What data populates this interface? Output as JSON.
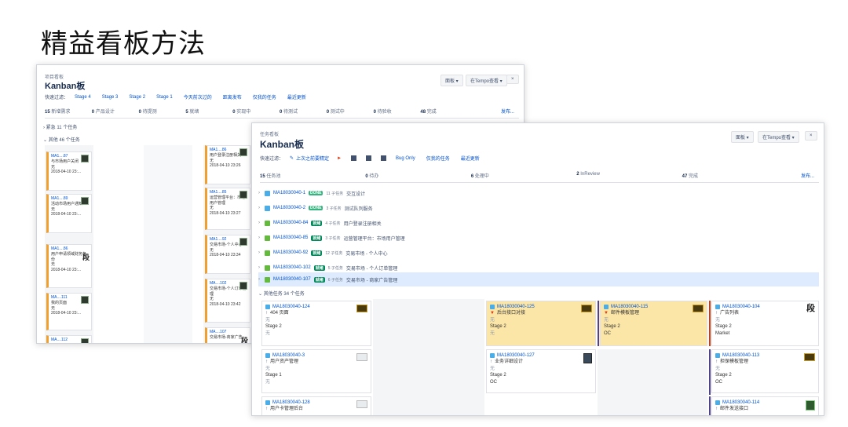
{
  "slide": {
    "title": "精益看板方法"
  },
  "shot1": {
    "crumb": "项目看板",
    "title": "Kanban板",
    "toolbar": {
      "board": "面板 ▾",
      "tempo": "在Tempo查看 ▾",
      "more": "×"
    },
    "quick_label": "快速过滤：",
    "quick_filters": [
      "Stage 4",
      "Stage 3",
      "Stage 2",
      "Stage 1",
      "今天前次过的",
      "距离发布",
      "仅我的任务",
      "最近更新"
    ],
    "columns": [
      {
        "count": "15",
        "name": "新增需求"
      },
      {
        "count": "0",
        "name": "产品设计"
      },
      {
        "count": "0",
        "name": "待提测"
      },
      {
        "count": "5",
        "name": "就绪"
      },
      {
        "count": "0",
        "name": "实现中"
      },
      {
        "count": "0",
        "name": "待测试"
      },
      {
        "count": "0",
        "name": "测试中"
      },
      {
        "count": "0",
        "name": "待验收"
      },
      {
        "count": "48",
        "name": "完成"
      }
    ],
    "release_label": "发布...",
    "swim1": "› 紧急 11 个任务",
    "swim2": "⌄ 其他 46 个任务",
    "cards_left": [
      {
        "key": "MA1....87",
        "title": "与市场用户关闭",
        "none": "无",
        "time": "2018-04-10 23:..."
      },
      {
        "key": "MA1....89",
        "title": "活动市场用户通知",
        "none": "无",
        "time": "2018-04-10 23:..."
      },
      {
        "key": "MA1....86",
        "title": "用户申请领域财务备份",
        "none": "无",
        "time": "2018-04-10 23:..."
      },
      {
        "key": "MA....111",
        "title": "我的页面",
        "none": "无",
        "time": "2018-04-10 23:..."
      },
      {
        "key": "MA....112",
        "title": "",
        "none": "",
        "time": ""
      }
    ],
    "cards_right": [
      {
        "key": "MA1....86",
        "title": "用户登录注册相关",
        "none": "无",
        "time": "2018-04-10 23:26"
      },
      {
        "key": "MA1....85",
        "title": "运营管理平台：市场用户管理",
        "none": "无",
        "time": "2018-04-10 23:27"
      },
      {
        "key": "MA1....92",
        "title": "交易市场-个人中心",
        "none": "无",
        "time": "2018-04-10 23:34"
      },
      {
        "key": "MA....102",
        "title": "交易市场-个人订单管理",
        "none": "无",
        "time": "2018-04-10 23:42"
      },
      {
        "key": "MA....107",
        "title": "交易市场-商家广告",
        "none": "",
        "time": ""
      }
    ]
  },
  "shot2": {
    "crumb": "任务看板",
    "title": "Kanban板",
    "toolbar": {
      "board": "面板 ▾",
      "tempo": "在Tempo查看 ▾",
      "more": "×"
    },
    "quick_label": "快速过滤：",
    "quick_filters": [
      "上次之前要精定",
      "Bug Only",
      "仅我的任务",
      "最近更新"
    ],
    "columns": [
      {
        "count": "15",
        "name": "任务池"
      },
      {
        "count": "0",
        "name": "待办"
      },
      {
        "count": "6",
        "name": "处理中"
      },
      {
        "count": "2",
        "name": "InReview"
      },
      {
        "count": "47",
        "name": "完成"
      }
    ],
    "release_label": "发布...",
    "epics": [
      {
        "key": "MA18030040-1",
        "lozenge": "DONE",
        "sub": "11 子任务",
        "title": "交互设计"
      },
      {
        "key": "MA18030040-2",
        "lozenge": "DONE",
        "sub": "3 子任务",
        "title": "测试队列服务"
      },
      {
        "key": "MA18030040-84",
        "lozenge": "就绪",
        "sub": "4 子任务",
        "title": "用户登录注册相关"
      },
      {
        "key": "MA18030040-85",
        "lozenge": "就绪",
        "sub": "3 子任务",
        "title": "运营管理平台：市场用户管理"
      },
      {
        "key": "MA18030040-92",
        "lozenge": "就绪",
        "sub": "12 子任务",
        "title": "交易市场 - 个人中心"
      },
      {
        "key": "MA18030040-102",
        "lozenge": "就绪",
        "sub": "5 子任务",
        "title": "交易市场 - 个人订单管理"
      },
      {
        "key": "MA18030040-107",
        "lozenge": "就绪",
        "sub": "6 子任务",
        "title": "交易市场 - 商家广告管理"
      }
    ],
    "other_swim": "⌄ 其他任务 34 个任务",
    "cards": [
      {
        "key": "MA18030040-124",
        "title": "404 页面",
        "none": "无",
        "stage": "Stage 2",
        "none2": "无"
      },
      {
        "key": "MA18030040-125",
        "title": "后台接口对接",
        "none": "无",
        "stage": "Stage 2",
        "none2": "无"
      },
      {
        "key": "MA18030040-115",
        "title": "邮件模板管理",
        "none": "无",
        "stage": "Stage 2",
        "none2": "OC"
      },
      {
        "key": "MA18030040-104",
        "title": "广告列表",
        "none": "无",
        "stage": "Stage 2",
        "none2": "Market"
      },
      {
        "key": "MA18030040-3",
        "title": "用户资产管理",
        "none": "无",
        "stage": "Stage 1",
        "none2": "无"
      },
      {
        "key": "MA18030040-127",
        "title": "业务详细设计",
        "none": "无",
        "stage": "Stage 2",
        "none2": "OC"
      },
      {
        "key": "MA18030040-113",
        "title": "担保模板管理",
        "none": "无",
        "stage": "Stage 2",
        "none2": "OC"
      },
      {
        "key": "MA18030040-128",
        "title": "用户卡管理后台",
        "none": "",
        "stage": "",
        "none2": ""
      },
      {
        "key": "MA18030040-114",
        "title": "邮件发送接口",
        "none": "",
        "stage": "",
        "none2": ""
      }
    ]
  }
}
